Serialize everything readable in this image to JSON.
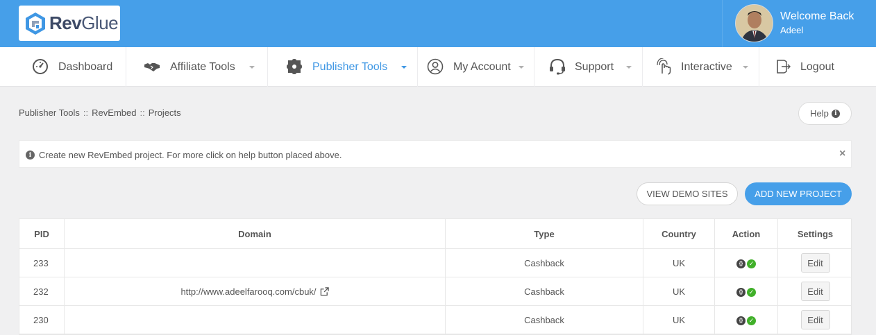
{
  "header": {
    "logo": {
      "rev": "Rev",
      "glue": "Glue"
    },
    "welcome": "Welcome Back",
    "username": "Adeel"
  },
  "nav": {
    "items": [
      {
        "label": "Dashboard",
        "icon": "speedometer-icon"
      },
      {
        "label": "Affiliate Tools",
        "icon": "handshake-icon"
      },
      {
        "label": "Publisher Tools",
        "icon": "puzzle-icon",
        "active": true
      },
      {
        "label": "My Account",
        "icon": "user-circle-icon"
      },
      {
        "label": "Support",
        "icon": "headset-icon"
      },
      {
        "label": "Interactive",
        "icon": "touch-icon"
      },
      {
        "label": "Logout",
        "icon": "logout-icon"
      }
    ]
  },
  "breadcrumb": {
    "a": "Publisher Tools",
    "b": "RevEmbed",
    "c": "Projects",
    "sep": "::"
  },
  "help_label": "Help",
  "alert": {
    "text": "Create new RevEmbed project. For more click on help button placed above.",
    "close": "×"
  },
  "buttons": {
    "demo": "VIEW DEMO SITES",
    "add": "ADD NEW PROJECT"
  },
  "table": {
    "headers": {
      "pid": "PID",
      "domain": "Domain",
      "type": "Type",
      "country": "Country",
      "action": "Action",
      "settings": "Settings"
    },
    "rows": [
      {
        "pid": "233",
        "domain": "",
        "type": "Cashback",
        "country": "UK",
        "edit": "Edit"
      },
      {
        "pid": "232",
        "domain": "http://www.adeelfarooq.com/cbuk/",
        "type": "Cashback",
        "country": "UK",
        "edit": "Edit"
      },
      {
        "pid": "230",
        "domain": "",
        "type": "Cashback",
        "country": "UK",
        "edit": "Edit"
      }
    ]
  },
  "colors": {
    "brand_blue": "#469fe9",
    "active_nav": "#3f97e4",
    "success_green": "#41b02a"
  }
}
